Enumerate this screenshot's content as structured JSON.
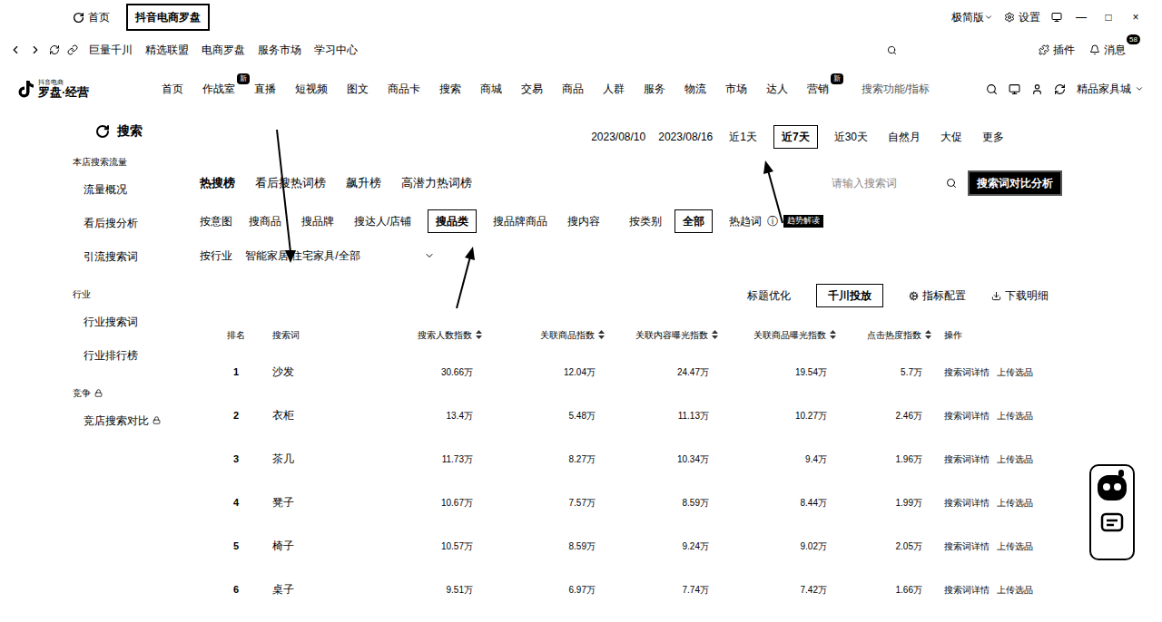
{
  "top_bar": {
    "home": "首页",
    "active_tab": "抖音电商罗盘",
    "mode": "极简版",
    "settings": "设置",
    "controls": [
      "—",
      "□",
      "×"
    ]
  },
  "bookmarks": {
    "items": [
      "巨量千川",
      "精选联盟",
      "电商罗盘",
      "服务市场",
      "学习中心"
    ],
    "plugins": "插件",
    "messages": "消息",
    "message_count": "58"
  },
  "nav": {
    "logo_small": "抖音电商",
    "logo": "罗盘·经营",
    "items": [
      {
        "label": "首页",
        "badge": ""
      },
      {
        "label": "作战室",
        "badge": "新"
      },
      {
        "label": "直播",
        "badge": ""
      },
      {
        "label": "短视频",
        "badge": ""
      },
      {
        "label": "图文",
        "badge": ""
      },
      {
        "label": "商品卡",
        "badge": ""
      },
      {
        "label": "搜索",
        "badge": ""
      },
      {
        "label": "商城",
        "badge": ""
      },
      {
        "label": "交易",
        "badge": ""
      },
      {
        "label": "商品",
        "badge": ""
      },
      {
        "label": "人群",
        "badge": ""
      },
      {
        "label": "服务",
        "badge": ""
      },
      {
        "label": "物流",
        "badge": ""
      },
      {
        "label": "市场",
        "badge": ""
      },
      {
        "label": "达人",
        "badge": ""
      },
      {
        "label": "营销",
        "badge": "新"
      }
    ],
    "search_placeholder": "搜索功能/指标",
    "store": "精品家具城"
  },
  "sidebar": {
    "title": "搜索",
    "groups": [
      {
        "label": "本店搜索流量",
        "locked": false,
        "items": [
          {
            "label": "流量概况",
            "locked": false
          },
          {
            "label": "看后搜分析",
            "locked": false
          },
          {
            "label": "引流搜索词",
            "locked": false
          }
        ]
      },
      {
        "label": "行业",
        "locked": false,
        "items": [
          {
            "label": "行业搜索词",
            "locked": false
          },
          {
            "label": "行业排行榜",
            "locked": false
          }
        ]
      },
      {
        "label": "竞争",
        "locked": true,
        "items": [
          {
            "label": "竞店搜索对比",
            "locked": true
          }
        ]
      }
    ]
  },
  "date_range": {
    "start": "2023/08/10",
    "end": "2023/08/16",
    "options": [
      {
        "label": "近1天",
        "selected": false
      },
      {
        "label": "近7天",
        "selected": true
      },
      {
        "label": "近30天",
        "selected": false
      },
      {
        "label": "自然月",
        "selected": false
      },
      {
        "label": "大促",
        "selected": false
      },
      {
        "label": "更多",
        "selected": false
      }
    ]
  },
  "tabs": [
    {
      "label": "热搜榜",
      "selected": true
    },
    {
      "label": "看后搜热词榜",
      "selected": false
    },
    {
      "label": "飙升榜",
      "selected": false
    },
    {
      "label": "高潜力热词榜",
      "selected": false
    }
  ],
  "search": {
    "placeholder": "请输入搜索词",
    "compare_button": "搜索词对比分析"
  },
  "intent_filter": {
    "label": "按意图",
    "options": [
      {
        "label": "搜商品",
        "selected": false
      },
      {
        "label": "搜品牌",
        "selected": false
      },
      {
        "label": "搜达人/店铺",
        "selected": false
      },
      {
        "label": "搜品类",
        "selected": true
      },
      {
        "label": "搜品牌商品",
        "selected": false
      },
      {
        "label": "搜内容",
        "selected": false
      }
    ]
  },
  "category_filter": {
    "label": "按类别",
    "options": [
      {
        "label": "全部",
        "selected": true
      },
      {
        "label": "热趋词",
        "selected": false
      }
    ],
    "info": "ⓘ",
    "badge": "趋势解读"
  },
  "industry": {
    "label": "按行业",
    "value": "智能家居/住宅家具/全部"
  },
  "toolbar": {
    "items": [
      {
        "label": "标题优化",
        "selected": false
      },
      {
        "label": "千川投放",
        "selected": true
      },
      {
        "label": "指标配置",
        "selected": false
      },
      {
        "label": "下载明细",
        "selected": false
      }
    ]
  },
  "table": {
    "columns": [
      {
        "label": "排名",
        "sortable": false
      },
      {
        "label": "搜索词",
        "sortable": false
      },
      {
        "label": "搜索人数指数",
        "sortable": true
      },
      {
        "label": "关联商品指数",
        "sortable": true
      },
      {
        "label": "关联内容曝光指数",
        "sortable": true
      },
      {
        "label": "关联商品曝光指数",
        "sortable": true
      },
      {
        "label": "点击热度指数",
        "sortable": true
      },
      {
        "label": "操作",
        "sortable": false
      }
    ],
    "rows": [
      {
        "rank": "1",
        "word": "沙发",
        "values": [
          "30.66万",
          "12.04万",
          "24.47万",
          "19.54万",
          "5.7万"
        ]
      },
      {
        "rank": "2",
        "word": "衣柜",
        "values": [
          "13.4万",
          "5.48万",
          "11.13万",
          "10.27万",
          "2.46万"
        ]
      },
      {
        "rank": "3",
        "word": "茶几",
        "values": [
          "11.73万",
          "8.27万",
          "10.34万",
          "9.4万",
          "1.96万"
        ]
      },
      {
        "rank": "4",
        "word": "凳子",
        "values": [
          "10.67万",
          "7.57万",
          "8.59万",
          "8.44万",
          "1.99万"
        ]
      },
      {
        "rank": "5",
        "word": "椅子",
        "values": [
          "10.57万",
          "8.59万",
          "9.24万",
          "9.02万",
          "2.05万"
        ]
      },
      {
        "rank": "6",
        "word": "桌子",
        "values": [
          "9.51万",
          "6.97万",
          "7.74万",
          "7.42万",
          "1.66万"
        ]
      }
    ],
    "actions": [
      "搜索词详情",
      "上传选品"
    ]
  }
}
